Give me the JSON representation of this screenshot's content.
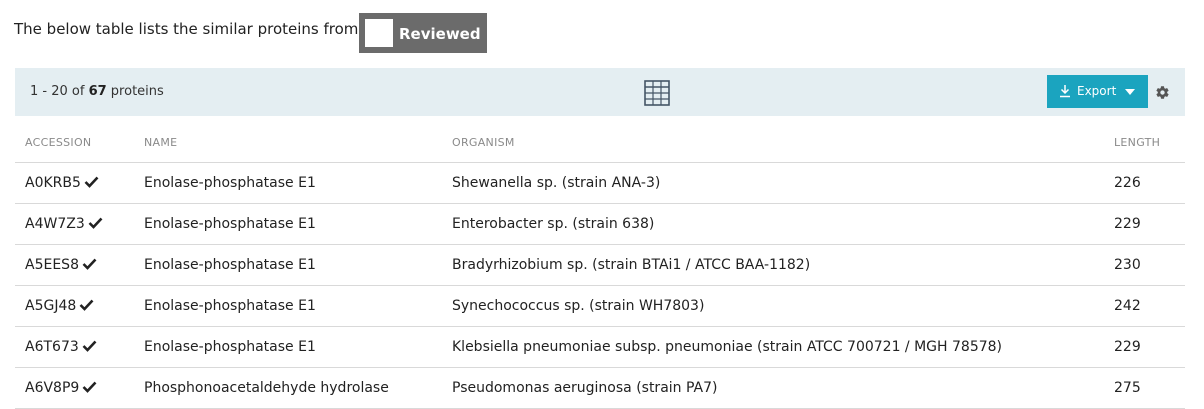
{
  "intro": {
    "text": "The below table lists the similar proteins from",
    "toggle_label": "Reviewed"
  },
  "toolbar": {
    "range": "1 - 20 of ",
    "total": "67",
    "unit": " proteins",
    "export_label": "Export"
  },
  "table": {
    "columns": [
      "ACCESSION",
      "NAME",
      "ORGANISM",
      "LENGTH"
    ],
    "rows": [
      {
        "accession": "A0KRB5",
        "name": "Enolase-phosphatase E1",
        "organism": "Shewanella sp. (strain ANA-3)",
        "length": "226"
      },
      {
        "accession": "A4W7Z3",
        "name": "Enolase-phosphatase E1",
        "organism": "Enterobacter sp. (strain 638)",
        "length": "229"
      },
      {
        "accession": "A5EES8",
        "name": "Enolase-phosphatase E1",
        "organism": "Bradyrhizobium sp. (strain BTAi1 / ATCC BAA-1182)",
        "length": "230"
      },
      {
        "accession": "A5GJ48",
        "name": "Enolase-phosphatase E1",
        "organism": "Synechococcus sp. (strain WH7803)",
        "length": "242"
      },
      {
        "accession": "A6T673",
        "name": "Enolase-phosphatase E1",
        "organism": "Klebsiella pneumoniae subsp. pneumoniae (strain ATCC 700721 / MGH 78578)",
        "length": "229"
      },
      {
        "accession": "A6V8P9",
        "name": "Phosphonoacetaldehyde hydrolase",
        "organism": "Pseudomonas aeruginosa (strain PA7)",
        "length": "275"
      }
    ]
  },
  "icons": {
    "grid": "grid-view-icon",
    "download": "download-icon",
    "caret": "caret-down-icon",
    "settings": "gear-icon",
    "reviewed": "checkmark-icon"
  },
  "colors": {
    "toolbar_bg": "#e4eef2",
    "accent": "#1ba4bf",
    "toggle_bg": "#6b6b6b"
  }
}
